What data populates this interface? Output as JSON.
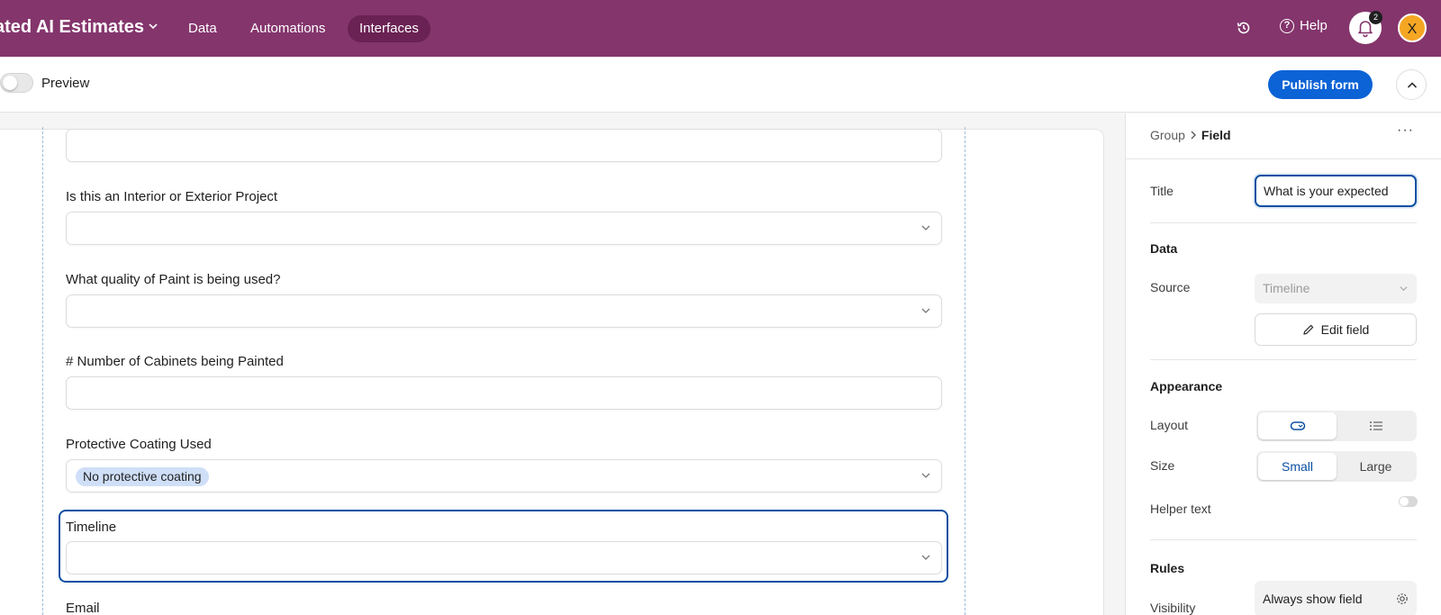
{
  "topbar": {
    "app_title": "ated AI Estimates",
    "nav": [
      "Data",
      "Automations",
      "Interfaces"
    ],
    "active_nav": "Interfaces",
    "help_label": "Help",
    "notification_count": "2",
    "avatar_initial": "X",
    "bg_color": "#84356c"
  },
  "subbar": {
    "preview_label": "Preview",
    "publish_label": "Publish form"
  },
  "form": {
    "fields": [
      {
        "label": "",
        "type": "text",
        "value": ""
      },
      {
        "label": "Is this an Interior or Exterior Project",
        "type": "select",
        "value": ""
      },
      {
        "label": "What quality of Paint is being used?",
        "type": "select",
        "value": ""
      },
      {
        "label": "# Number of Cabinets being Painted",
        "type": "text",
        "value": ""
      },
      {
        "label": "Protective Coating Used",
        "type": "select",
        "value": "No protective coating"
      },
      {
        "label": "Timeline",
        "type": "select",
        "value": "",
        "selected": true
      },
      {
        "label": "Email",
        "type": "text",
        "value": ""
      }
    ]
  },
  "panel": {
    "breadcrumb_parent": "Group",
    "breadcrumb_current": "Field",
    "more_label": "···",
    "title_label": "Title",
    "title_value": "What is your expected",
    "data_heading": "Data",
    "source_label": "Source",
    "source_value": "Timeline",
    "edit_field_label": "Edit field",
    "appearance_heading": "Appearance",
    "layout_label": "Layout",
    "layout_selected": "dropdown",
    "size_label": "Size",
    "size_options": [
      "Small",
      "Large"
    ],
    "size_selected": "Small",
    "helper_label": "Helper text",
    "helper_on": false,
    "rules_heading": "Rules",
    "visibility_label": "Visibility",
    "visibility_value": "Always show field"
  },
  "colors": {
    "accent": "#0b63d6",
    "selected_outline": "#0b4fa3",
    "chip_bg": "#cfdff7"
  }
}
